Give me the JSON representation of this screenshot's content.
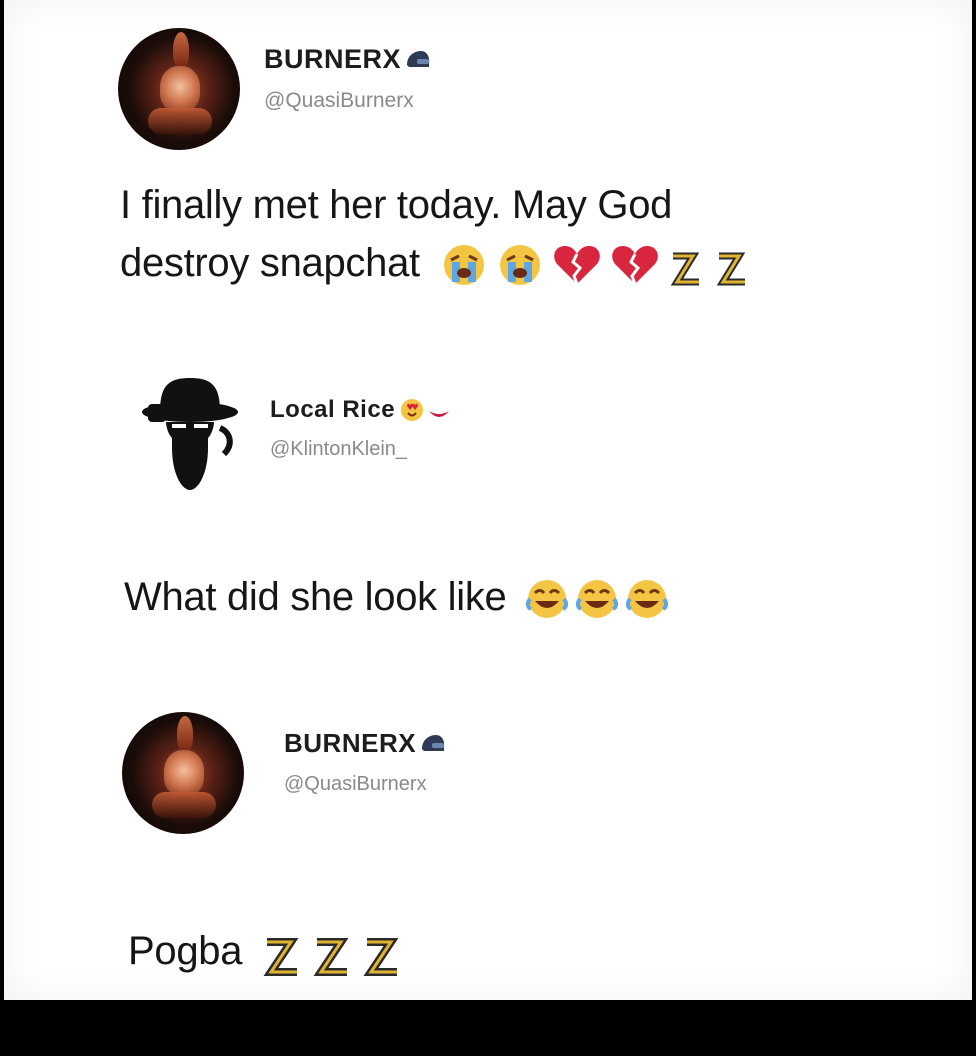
{
  "colors": {
    "text": "#161616",
    "handle": "#8a8a8a",
    "background": "#ffffff",
    "letterbox": "#000000"
  },
  "thread": [
    {
      "display_name": "BURNERX",
      "name_icon": "helmet-icon",
      "handle": "@QuasiBurnerx",
      "avatar": "burner-avatar",
      "text": "I finally met her today. May God",
      "text_line2": "destroy snapchat",
      "emojis": [
        "crying-face-icon",
        "crying-face-icon",
        "broken-heart-icon",
        "broken-heart-icon",
        "sleeping-zz-icon",
        "sleeping-zz-icon"
      ]
    },
    {
      "display_name": "Local Rice",
      "name_icon": "heart-eyes-lips-icon",
      "handle": "@KlintonKlein_",
      "avatar": "bearded-man-hat-avatar",
      "text": "What did she look like",
      "emojis": [
        "laughing-face-icon",
        "laughing-face-icon",
        "laughing-face-icon"
      ]
    },
    {
      "display_name": "BURNERX",
      "name_icon": "helmet-icon",
      "handle": "@QuasiBurnerx",
      "avatar": "burner-avatar",
      "text": "Pogba",
      "emojis": [
        "sleeping-zz-icon",
        "sleeping-zz-icon",
        "sleeping-zz-icon"
      ]
    }
  ]
}
